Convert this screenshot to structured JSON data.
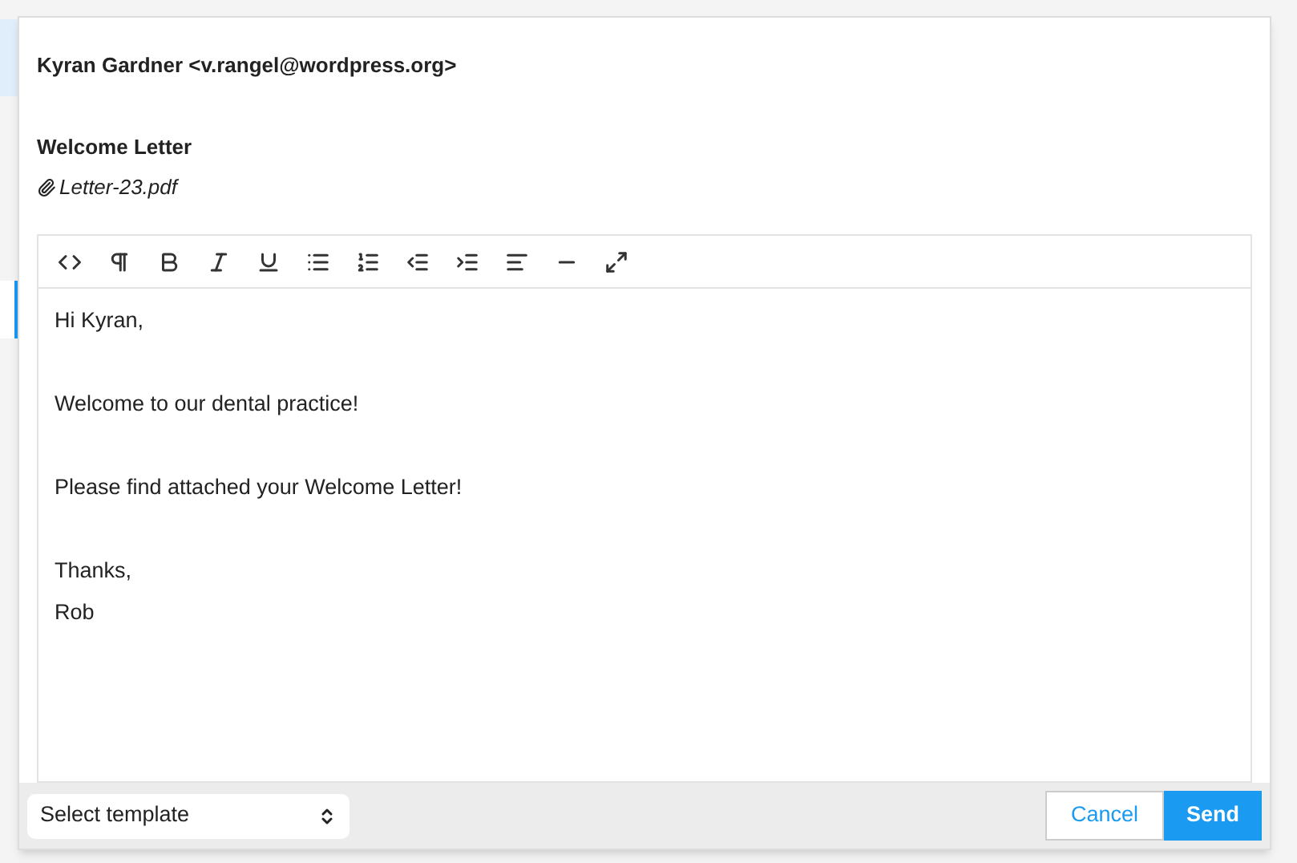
{
  "email": {
    "recipient": "Kyran Gardner <v.rangel@wordpress.org>",
    "subject": "Welcome Letter",
    "attachment": "Letter-23.pdf",
    "body": [
      [
        "Hi Kyran,"
      ],
      [
        "Welcome to our dental practice!"
      ],
      [
        "Please find attached your Welcome Letter!"
      ],
      [
        "Thanks,",
        "Rob"
      ]
    ]
  },
  "footer": {
    "template_select": "Select template",
    "buttons": [
      "Cancel",
      "Send"
    ]
  }
}
